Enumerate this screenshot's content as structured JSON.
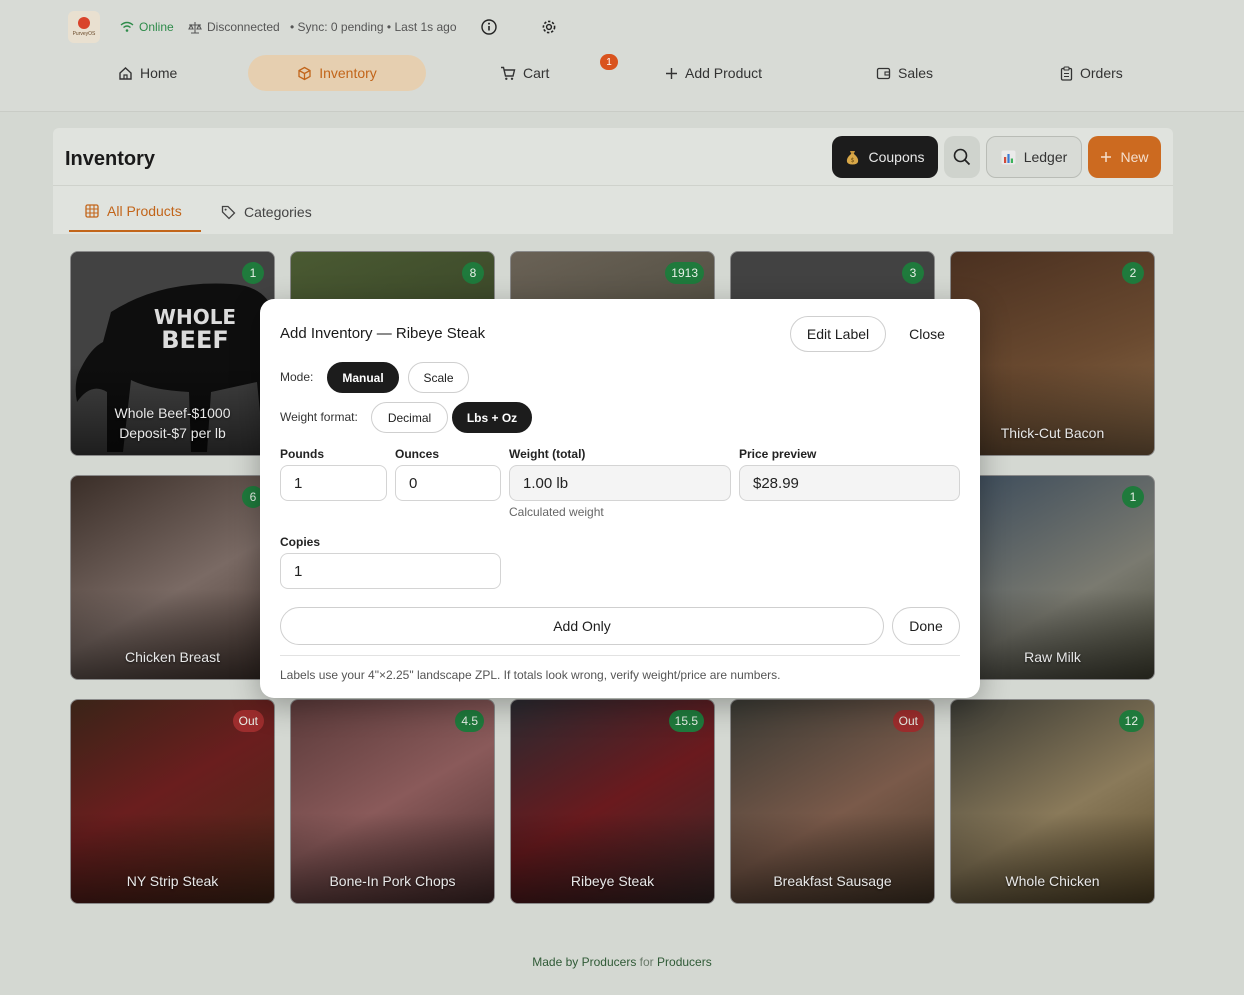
{
  "header": {
    "logo_text": "PurveyOS",
    "online_label": "Online",
    "disconnected_label": "Disconnected",
    "sync_text": "• Sync: 0 pending • Last 1s ago"
  },
  "nav": {
    "home": "Home",
    "inventory": "Inventory",
    "cart": "Cart",
    "cart_count": "1",
    "add_product": "Add Product",
    "sales": "Sales",
    "orders": "Orders"
  },
  "inventory": {
    "title": "Inventory",
    "coupons": "Coupons",
    "ledger": "Ledger",
    "new": "New",
    "tabs": {
      "all_products": "All Products",
      "categories": "Categories"
    }
  },
  "products": [
    {
      "name": "Whole Beef-$1000 Deposit-$7 per lb",
      "badge": "1",
      "status": "in"
    },
    {
      "name": "",
      "badge": "8",
      "status": "in"
    },
    {
      "name": "",
      "badge": "1913",
      "status": "in"
    },
    {
      "name": "",
      "badge": "3",
      "status": "in"
    },
    {
      "name": "Thick-Cut Bacon",
      "badge": "2",
      "status": "in"
    },
    {
      "name": "Chicken Breast",
      "badge": "6",
      "status": "in"
    },
    {
      "name": "Raw Milk",
      "badge": "1",
      "status": "in"
    },
    {
      "name": "NY Strip Steak",
      "badge": "Out",
      "status": "out"
    },
    {
      "name": "Bone-In Pork Chops",
      "badge": "4.5",
      "status": "in"
    },
    {
      "name": "Ribeye Steak",
      "badge": "15.5",
      "status": "in"
    },
    {
      "name": "Breakfast Sausage",
      "badge": "Out",
      "status": "out"
    },
    {
      "name": "Whole Chicken",
      "badge": "12",
      "status": "in"
    }
  ],
  "whole_beef_art": {
    "line1": "WHOLE",
    "line2": "BEEF"
  },
  "modal": {
    "title": "Add Inventory — Ribeye Steak",
    "edit_label": "Edit Label",
    "close": "Close",
    "mode_label": "Mode:",
    "mode_options": [
      "Manual",
      "Scale"
    ],
    "mode_selected": "Manual",
    "weight_format_label": "Weight format:",
    "weight_format_options": [
      "Decimal",
      "Lbs + Oz"
    ],
    "weight_format_selected": "Lbs + Oz",
    "pounds_label": "Pounds",
    "pounds_value": "1",
    "ounces_label": "Ounces",
    "ounces_value": "0",
    "weight_total_label": "Weight (total)",
    "weight_total_value": "1.00 lb",
    "calculated_hint": "Calculated weight",
    "price_preview_label": "Price preview",
    "price_preview_value": "$28.99",
    "copies_label": "Copies",
    "copies_value": "1",
    "add_only": "Add Only",
    "done": "Done",
    "footnote": "Labels use your 4\"×2.25\" landscape ZPL. If totals look wrong, verify weight/price are numbers."
  },
  "footer": {
    "made_by": "Made by Producers",
    "for": "for",
    "producers": "Producers"
  },
  "colors": {
    "accent": "#c2651a",
    "badge_green": "#1f7a3c",
    "badge_red": "#9c2d2d",
    "online": "#2e8b4a"
  }
}
